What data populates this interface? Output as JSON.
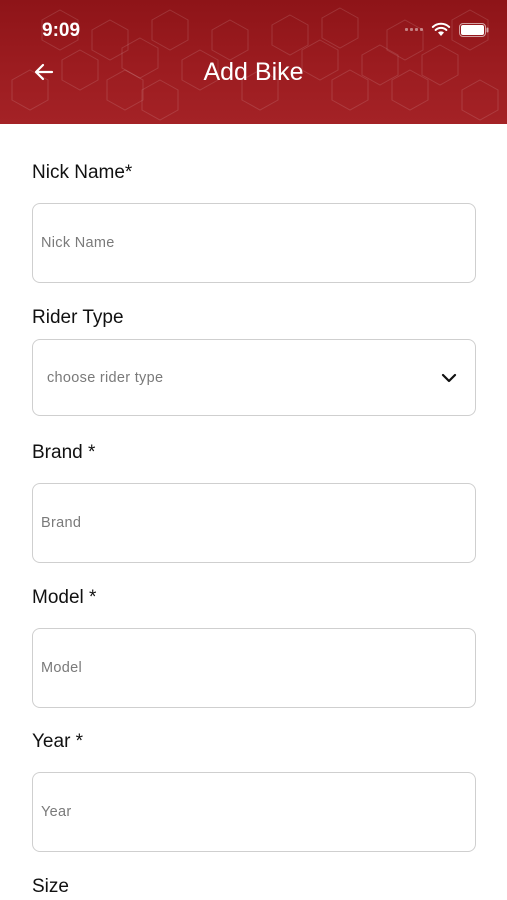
{
  "status_bar": {
    "time": "9:09"
  },
  "header": {
    "title": "Add Bike"
  },
  "form": {
    "nickname_label": "Nick Name*",
    "nickname_placeholder": "Nick Name",
    "rider_type_label": "Rider Type",
    "rider_type_placeholder": "choose rider type",
    "brand_label": "Brand *",
    "brand_placeholder": "Brand",
    "model_label": "Model *",
    "model_placeholder": "Model",
    "year_label": "Year *",
    "year_placeholder": "Year",
    "size_label": "Size"
  },
  "colors": {
    "header": "#9c1c20",
    "field_border": "#cfcfcf"
  },
  "icons": [
    "back-arrow-icon",
    "chevron-down-icon",
    "wifi-icon",
    "battery-icon",
    "signal-icon"
  ]
}
